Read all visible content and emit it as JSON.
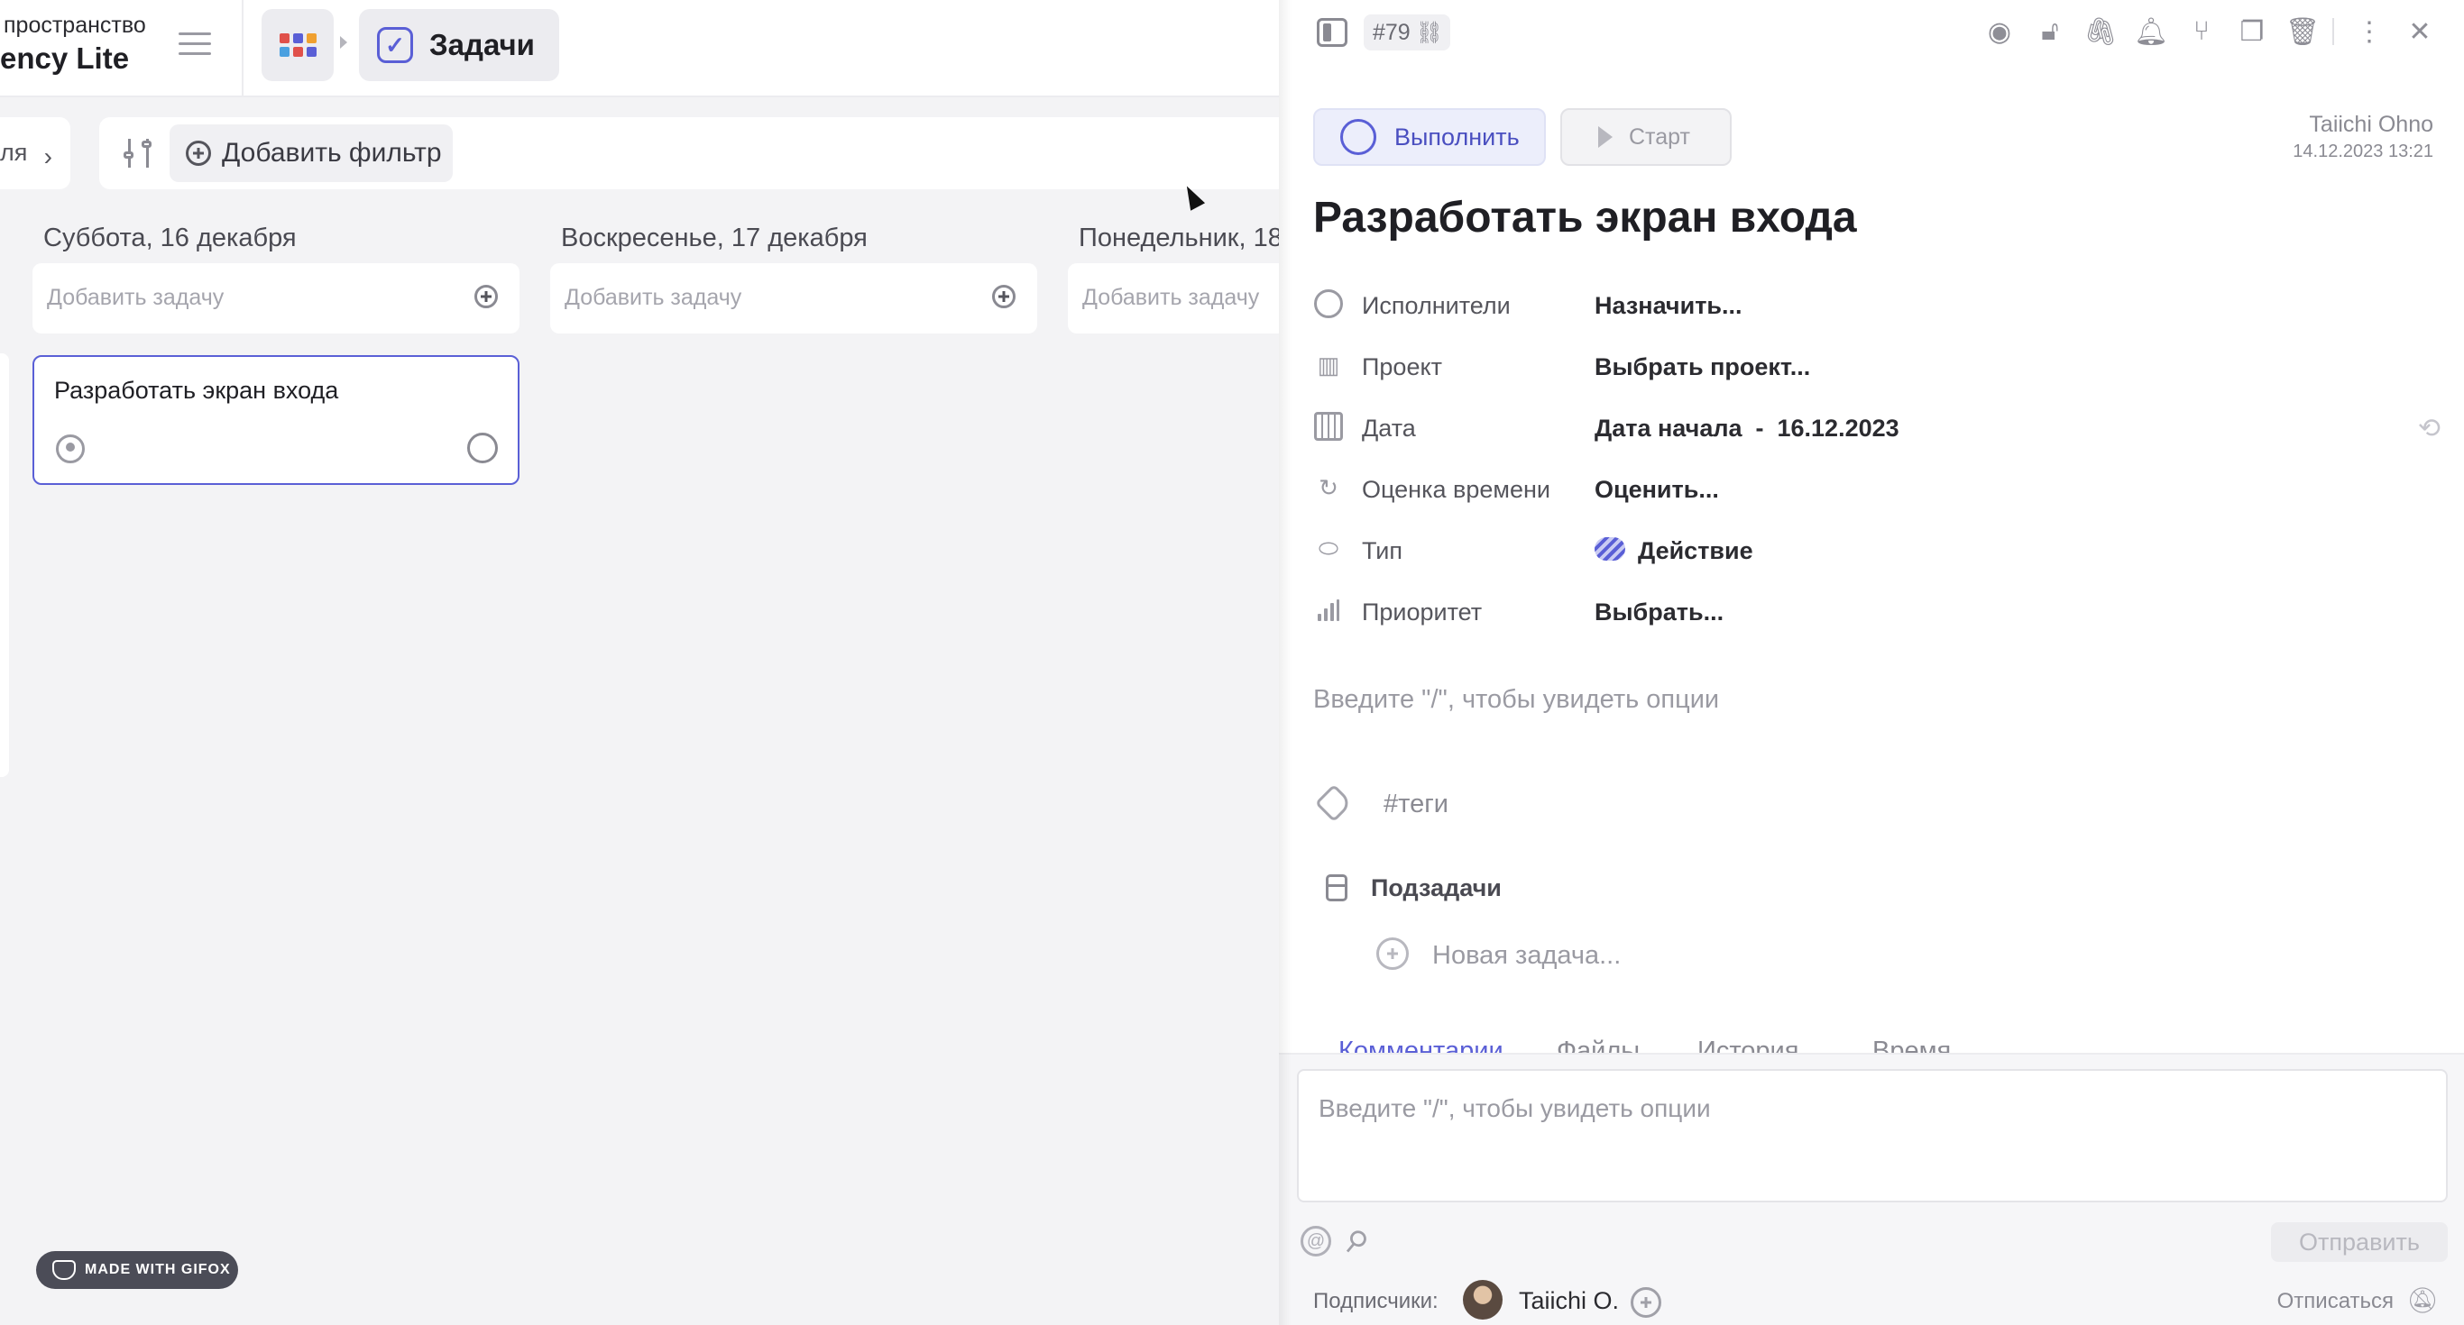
{
  "workspace": {
    "label": "пространство",
    "name": "ency Lite"
  },
  "breadcrumb": {
    "current": "Задачи"
  },
  "colors": {
    "accent": "#5a5fd6",
    "apps_icon": [
      "#e0504a",
      "#5a5fd6",
      "#f0a030",
      "#4aa0e0",
      "#e0504a",
      "#5a5fd6"
    ]
  },
  "filters": {
    "period_label": "ля",
    "add_filter_label": "Добавить фильтр"
  },
  "board": {
    "columns": [
      {
        "title": "Суббота, 16 декабря",
        "add_placeholder": "Добавить задачу"
      },
      {
        "title": "Воскресенье, 17 декабря",
        "add_placeholder": "Добавить задачу"
      },
      {
        "title": "Понедельник, 18 ",
        "add_placeholder": "Добавить задачу"
      }
    ],
    "card": {
      "title": "Разработать экран входа"
    }
  },
  "gifox_badge": "MADE WITH GIFOX",
  "panel": {
    "task_id": "#79",
    "toolbar_icons": [
      "eye-icon",
      "lock-icon",
      "paperclip-icon",
      "bell-icon",
      "tree-icon",
      "duplicate-icon",
      "trash-icon",
      "more-vertical-icon",
      "close-icon"
    ],
    "done_label": "Выполнить",
    "start_label": "Старт",
    "author": "Taiichi Ohno",
    "created": "14.12.2023 13:21",
    "title": "Разработать экран входа",
    "properties": {
      "assignees": {
        "label": "Исполнители",
        "value": "Назначить..."
      },
      "project": {
        "label": "Проект",
        "value": "Выбрать проект..."
      },
      "date": {
        "label": "Дата",
        "value": "Дата начала  -  16.12.2023"
      },
      "estimate": {
        "label": "Оценка времени",
        "value": "Оценить..."
      },
      "type": {
        "label": "Тип",
        "value": "Действие"
      },
      "priority": {
        "label": "Приоритет",
        "value": "Выбрать..."
      }
    },
    "description_placeholder": "Введите \"/\", чтобы увидеть опции",
    "tags_placeholder": "#теги",
    "subtasks_label": "Подзадачи",
    "new_subtask_placeholder": "Новая задача...",
    "tabs": [
      "Комментарии",
      "Файлы",
      "История",
      "Время"
    ],
    "comment_placeholder": "Введите \"/\", чтобы увидеть опции",
    "send_label": "Отправить",
    "subscribers_label": "Подписчики:",
    "subscriber_name": "Taiichi O.",
    "unsubscribe_label": "Отписаться"
  }
}
